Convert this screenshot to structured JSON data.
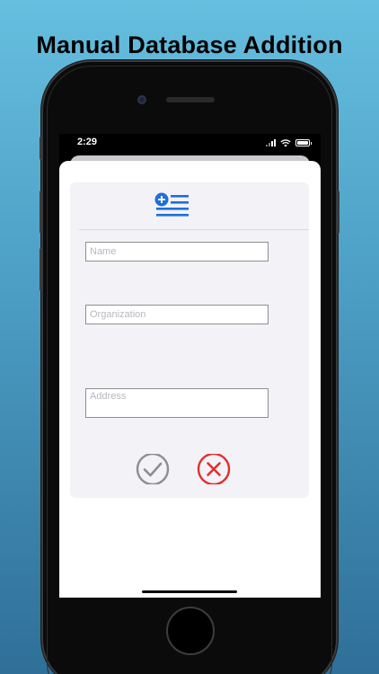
{
  "headline": "Manual Database Addition",
  "status_bar": {
    "time": "2:29"
  },
  "form": {
    "header_icon": "add-list-icon",
    "name_placeholder": "Name",
    "organization_placeholder": "Organization",
    "address_placeholder": "Address"
  },
  "actions": {
    "confirm_icon": "checkmark-circle-icon",
    "cancel_icon": "x-circle-icon"
  },
  "colors": {
    "accent_blue": "#1f6fd6",
    "confirm_gray": "#8e8e8e",
    "cancel_red": "#e2302c"
  }
}
